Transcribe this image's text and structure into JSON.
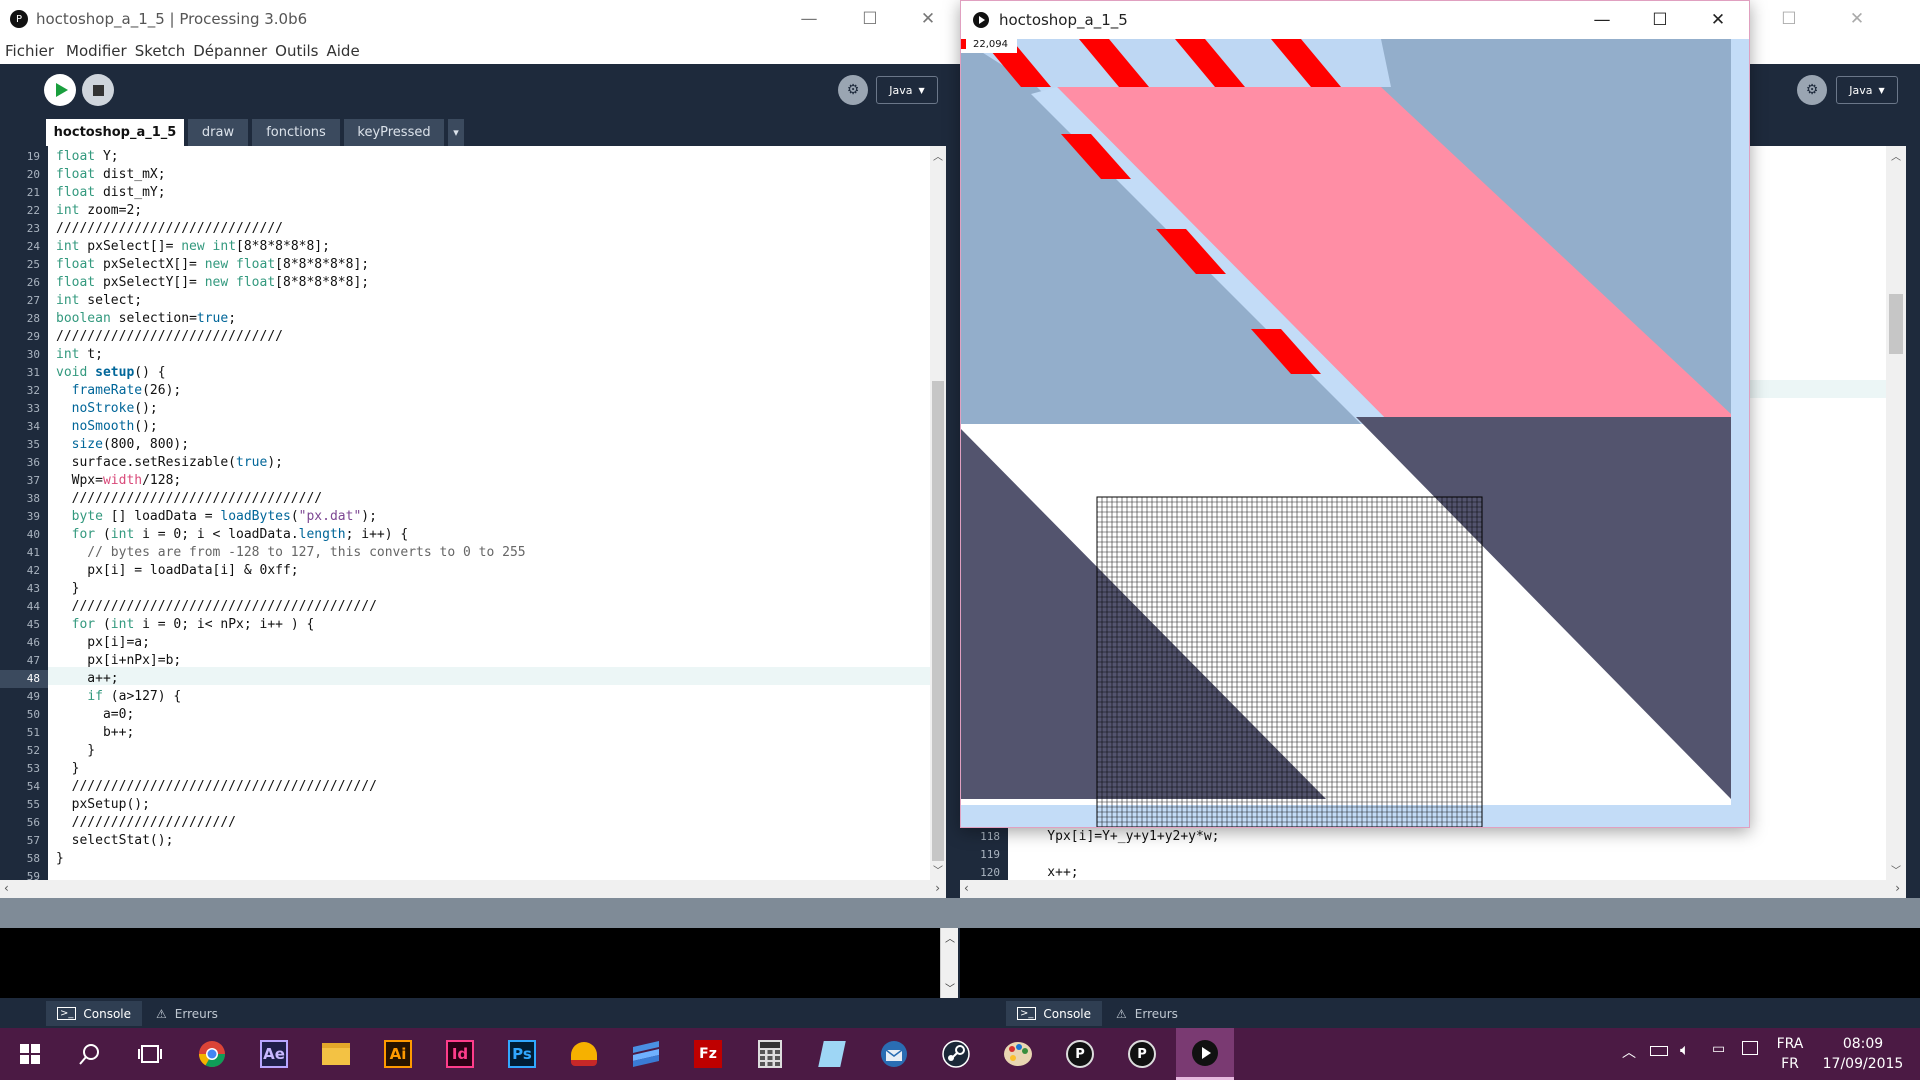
{
  "editor_left": {
    "title": "hoctoshop_a_1_5 | Processing 3.0b6",
    "menu": [
      "Fichier",
      "Modifier",
      "Sketch",
      "Dépanner",
      "Outils",
      "Aide"
    ],
    "mode": "Java",
    "tabs": [
      "hoctoshop_a_1_5",
      "draw",
      "fonctions",
      "keyPressed"
    ],
    "tabs_more": "▾",
    "lines": [
      {
        "n": "19",
        "t": "float Y;"
      },
      {
        "n": "20",
        "t": "float dist_mX;"
      },
      {
        "n": "21",
        "t": "float dist_mY;"
      },
      {
        "n": "22",
        "t": "int zoom=2;"
      },
      {
        "n": "23",
        "t": "/////////////////////////////"
      },
      {
        "n": "24",
        "t": "int pxSelect[]= new int[8*8*8*8*8];"
      },
      {
        "n": "25",
        "t": "float pxSelectX[]= new float[8*8*8*8*8];"
      },
      {
        "n": "26",
        "t": "float pxSelectY[]= new float[8*8*8*8*8];"
      },
      {
        "n": "27",
        "t": "int select;"
      },
      {
        "n": "28",
        "t": "boolean selection=true;"
      },
      {
        "n": "29",
        "t": "/////////////////////////////"
      },
      {
        "n": "30",
        "t": "int t;"
      },
      {
        "n": "31",
        "t": "void setup() {"
      },
      {
        "n": "32",
        "t": "  frameRate(26);"
      },
      {
        "n": "33",
        "t": "  noStroke();"
      },
      {
        "n": "34",
        "t": "  noSmooth();"
      },
      {
        "n": "35",
        "t": "  size(800, 800);"
      },
      {
        "n": "36",
        "t": "  surface.setResizable(true);"
      },
      {
        "n": "37",
        "t": "  Wpx=width/128;"
      },
      {
        "n": "38",
        "t": "  ////////////////////////////////"
      },
      {
        "n": "39",
        "t": "  byte [] loadData = loadBytes(\"px.dat\");"
      },
      {
        "n": "40",
        "t": "  for (int i = 0; i < loadData.length; i++) {"
      },
      {
        "n": "41",
        "t": "    // bytes are from -128 to 127, this converts to 0 to 255"
      },
      {
        "n": "42",
        "t": "    px[i] = loadData[i] & 0xff;"
      },
      {
        "n": "43",
        "t": "  }"
      },
      {
        "n": "44",
        "t": "  ///////////////////////////////////////"
      },
      {
        "n": "45",
        "t": "  for (int i = 0; i< nPx; i++ ) {"
      },
      {
        "n": "46",
        "t": "    px[i]=a;"
      },
      {
        "n": "47",
        "t": "    px[i+nPx]=b;"
      },
      {
        "n": "48",
        "t": "    a++;"
      },
      {
        "n": "49",
        "t": "    if (a>127) {"
      },
      {
        "n": "50",
        "t": "      a=0;"
      },
      {
        "n": "51",
        "t": "      b++;"
      },
      {
        "n": "52",
        "t": "    }"
      },
      {
        "n": "53",
        "t": "  }"
      },
      {
        "n": "54",
        "t": "  ///////////////////////////////////////"
      },
      {
        "n": "55",
        "t": "  pxSetup();"
      },
      {
        "n": "56",
        "t": "  /////////////////////"
      },
      {
        "n": "57",
        "t": "  selectStat();"
      },
      {
        "n": "58",
        "t": "}"
      },
      {
        "n": "59",
        "t": ""
      }
    ],
    "console_tab": "Console",
    "errors_tab": "Erreurs"
  },
  "editor_right": {
    "mode": "Java",
    "lines": [
      {
        "n": "118",
        "t": "    Ypx[i]=Y+_y+y1+y2+y*w;"
      },
      {
        "n": "119",
        "t": ""
      },
      {
        "n": "120",
        "t": "    x++;"
      }
    ],
    "console_tab": "Console",
    "errors_tab": "Erreurs"
  },
  "sketch": {
    "title": "hoctoshop_a_1_5",
    "fps": "22,094",
    "colors": {
      "blue": "#93aecb",
      "pink": "#ff8ea5",
      "red": "#ff0000",
      "light": "#c3dcf7",
      "navy": "#53546e",
      "white": "#ffffff"
    }
  },
  "taskbar": {
    "icons": [
      "windows-start",
      "search",
      "task-view",
      "chrome",
      "after-effects",
      "file-explorer",
      "illustrator",
      "indesign",
      "photoshop",
      "security-helmet",
      "sublime",
      "filezilla",
      "calculator",
      "notes",
      "thunderbird",
      "steam",
      "paint",
      "processing-1",
      "processing-2",
      "sketch-running"
    ],
    "icon_labels": {
      "after-effects": "Ae",
      "illustrator": "Ai",
      "indesign": "Id",
      "photoshop": "Ps",
      "filezilla": "Fz"
    },
    "lang_top": "FRA",
    "lang_bottom": "FR",
    "time": "08:09",
    "date": "17/09/2015"
  }
}
